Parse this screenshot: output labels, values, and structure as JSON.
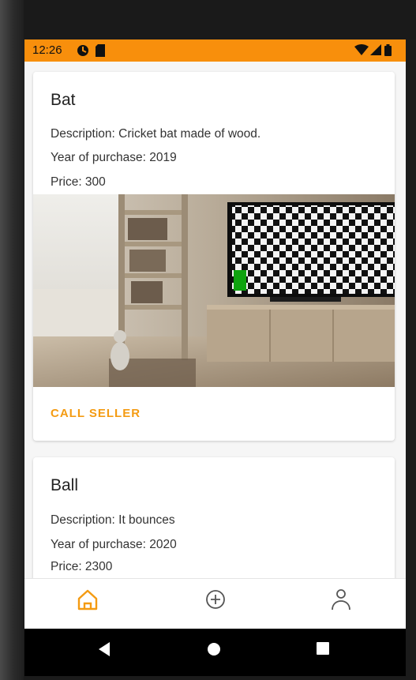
{
  "status_bar": {
    "time": "12:26",
    "background": "#f88f0c"
  },
  "cards": [
    {
      "title": "Bat",
      "description": "Description: Cricket bat made of wood.",
      "year": "Year of purchase: 2019",
      "price": "Price: 300",
      "action": "CALL SELLER"
    },
    {
      "title": "Ball",
      "description": "Description: It bounces",
      "year": "Year of purchase: 2020",
      "price": "Price: 2300"
    }
  ],
  "bottom_nav": {
    "items": [
      "home-icon",
      "add-circle-icon",
      "profile-icon"
    ],
    "active_color": "#f49b12"
  },
  "accent": "#f49b12"
}
